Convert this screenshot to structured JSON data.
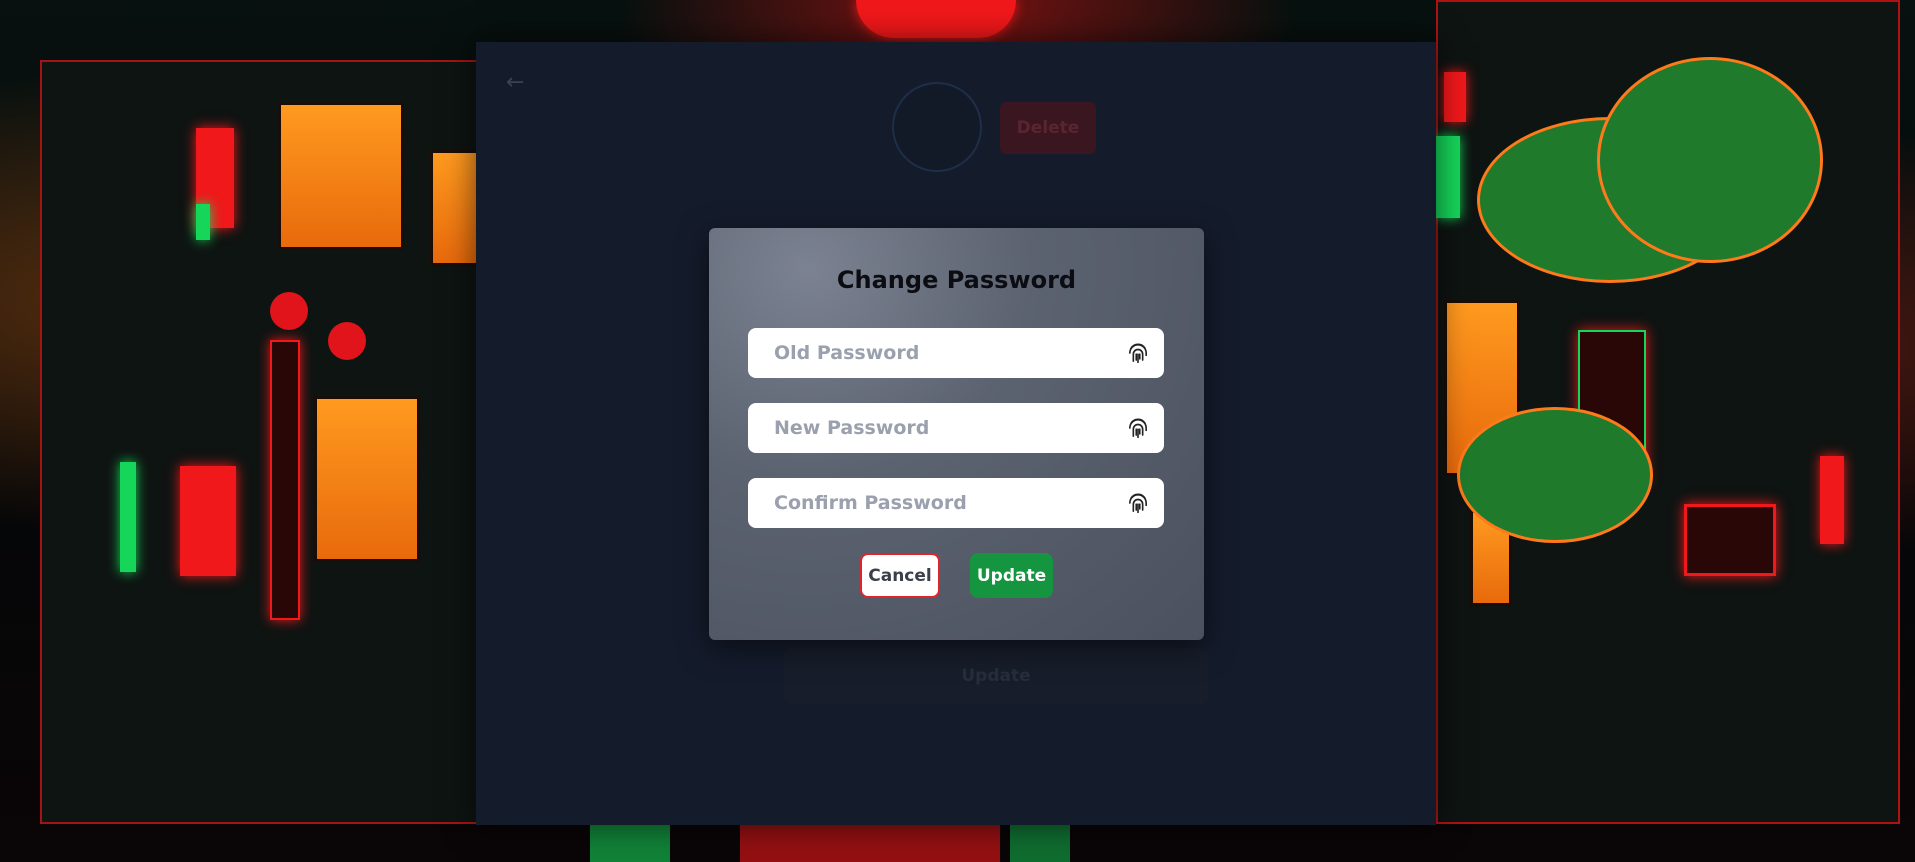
{
  "colors": {
    "panel": "#141b2b",
    "modal": "#5b6270",
    "accent_green": "#15953f",
    "cancel_border": "#e0242c"
  },
  "background_panel": {
    "back_icon": "arrow-left-icon",
    "delete_label": "Delete",
    "update_label": "Update"
  },
  "modal": {
    "title": "Change Password",
    "fields": [
      {
        "placeholder": "Old Password",
        "value": "",
        "icon": "fingerprint-icon"
      },
      {
        "placeholder": "New Password",
        "value": "",
        "icon": "fingerprint-icon"
      },
      {
        "placeholder": "Confirm Password",
        "value": "",
        "icon": "fingerprint-icon"
      }
    ],
    "cancel_label": "Cancel",
    "update_label": "Update"
  }
}
